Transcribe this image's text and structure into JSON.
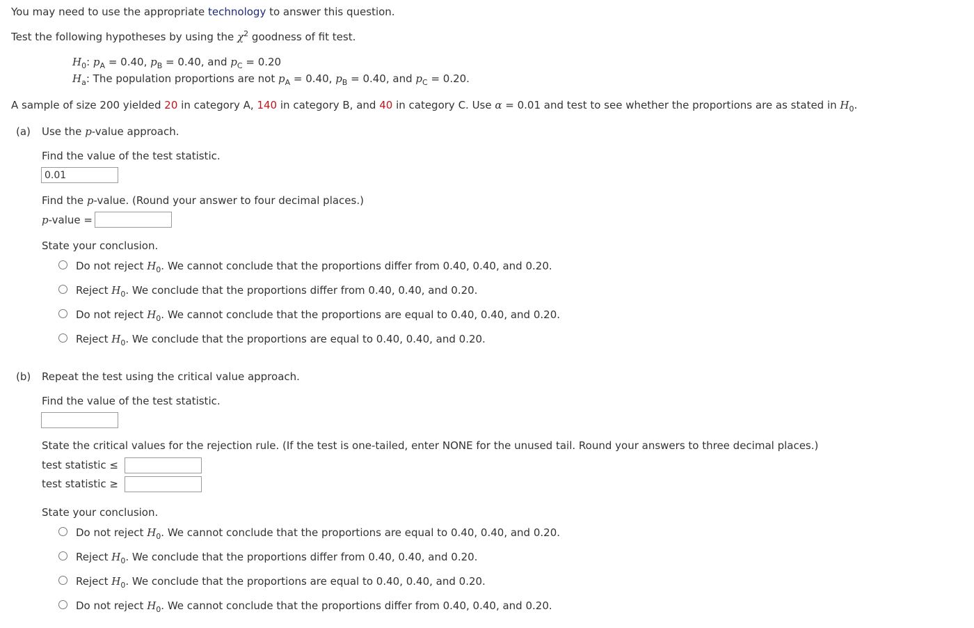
{
  "intro": {
    "line1_before": "You may need to use the appropriate ",
    "line1_link": "technology",
    "line1_after": " to answer this question.",
    "line2_before": "Test the following hypotheses by using the ",
    "chi": "χ",
    "chi_exp": "2",
    "line2_after": " goodness of fit test."
  },
  "hypotheses": {
    "h0_label": "H",
    "h0_sub": "0",
    "h0_text": [
      ": ",
      "p",
      "A",
      " = 0.40, ",
      "p",
      "B",
      " = 0.40, and ",
      "p",
      "C",
      " = 0.20"
    ],
    "ha_label": "H",
    "ha_sub": "a",
    "ha_text": [
      ": The population proportions are not ",
      "p",
      "A",
      " = 0.40, ",
      "p",
      "B",
      " = 0.40, and ",
      "p",
      "C",
      " = 0.20."
    ]
  },
  "sample": {
    "t1": "A sample of size 200 yielded ",
    "a": "20",
    "t2": " in category A, ",
    "b": "140",
    "t3": " in category B, and ",
    "c": "40",
    "t4": " in category C. Use ",
    "alpha": "α",
    "t5": " = 0.01 and test to see whether the proportions are as stated in ",
    "h": "H",
    "h_sub": "0",
    "t6": "."
  },
  "part_a": {
    "label": "(a)",
    "title_before": "Use the ",
    "title_p": "p",
    "title_after": "-value approach.",
    "stat_prompt": "Find the value of the test statistic.",
    "stat_value": "0.01",
    "pval_prompt_before": "Find the ",
    "pval_prompt_p": "p",
    "pval_prompt_after": "-value. (Round your answer to four decimal places.)",
    "pval_label_p": "p",
    "pval_label_after": "-value =",
    "pval_value": "",
    "conclusion_prompt": "State your conclusion.",
    "options": [
      {
        "pre": "Do not reject ",
        "post": ". We cannot conclude that the proportions differ from 0.40, 0.40, and 0.20."
      },
      {
        "pre": "Reject ",
        "post": ". We conclude that the proportions differ from 0.40, 0.40, and 0.20."
      },
      {
        "pre": "Do not reject ",
        "post": ". We cannot conclude that the proportions are equal to 0.40, 0.40, and 0.20."
      },
      {
        "pre": "Reject ",
        "post": ". We conclude that the proportions are equal to 0.40, 0.40, and 0.20."
      }
    ]
  },
  "part_b": {
    "label": "(b)",
    "title": "Repeat the test using the critical value approach.",
    "stat_prompt": "Find the value of the test statistic.",
    "stat_value": "",
    "crit_prompt": "State the critical values for the rejection rule. (If the test is one-tailed, enter NONE for the unused tail. Round your answers to three decimal places.)",
    "le_label": "test statistic ≤",
    "ge_label": "test statistic ≥",
    "le_value": "",
    "ge_value": "",
    "conclusion_prompt": "State your conclusion.",
    "options": [
      {
        "pre": "Do not reject ",
        "post": ". We cannot conclude that the proportions are equal to 0.40, 0.40, and 0.20."
      },
      {
        "pre": "Reject ",
        "post": ". We conclude that the proportions differ from 0.40, 0.40, and 0.20."
      },
      {
        "pre": "Reject ",
        "post": ". We conclude that the proportions are equal to 0.40, 0.40, and 0.20."
      },
      {
        "pre": "Do not reject ",
        "post": ". We cannot conclude that the proportions differ from 0.40, 0.40, and 0.20."
      }
    ]
  },
  "h_symbol": "H",
  "h_sub0": "0"
}
